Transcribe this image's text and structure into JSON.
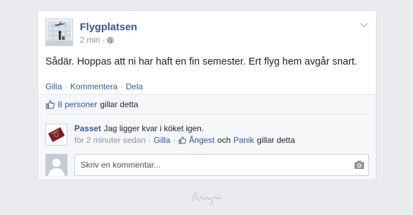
{
  "post": {
    "page_name": "Flygplatsen",
    "time": "2 min",
    "meta_separator": "·",
    "text": "Sådär. Hoppas att ni har haft en fin semester. Ert flyg hem avgår snart.",
    "actions": {
      "like": "Gilla",
      "comment": "Kommentera",
      "share": "Dela",
      "separator": "·"
    }
  },
  "likes": {
    "count_link": "8 personer",
    "suffix": "gillar detta"
  },
  "comment": {
    "author": "Passet",
    "text": "Jag ligger kvar i köket igen.",
    "time": "för 2 minuter sedan",
    "separator": "·",
    "like": "Gilla",
    "liker1": "Ångest",
    "conjunction": "och",
    "liker2": "Panik",
    "suffix": "gillar detta"
  },
  "reply": {
    "placeholder": "Skriv en kommentar..."
  },
  "colors": {
    "link": "#365899",
    "text": "#1d2129",
    "muted": "#90949c",
    "background": "#e9ebee"
  },
  "icons": {
    "globe": "globe-icon",
    "chevron": "chevron-down-icon",
    "thumb": "thumbs-up-icon",
    "camera": "camera-icon",
    "watermark": "signature-logo"
  }
}
